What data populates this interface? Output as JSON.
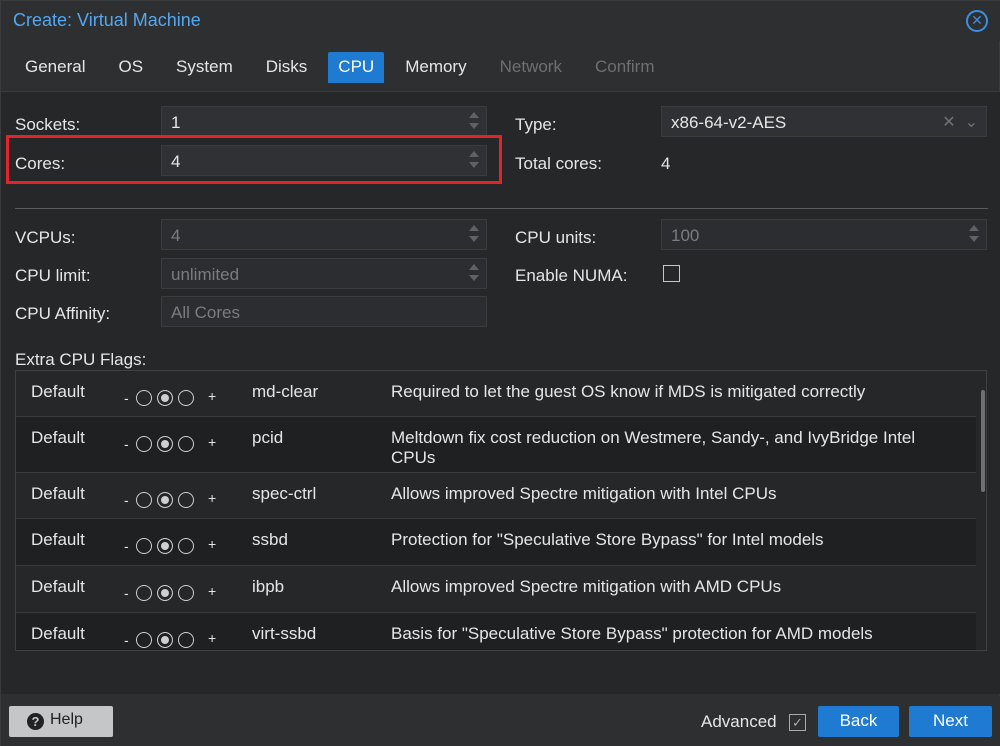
{
  "window": {
    "title": "Create: Virtual Machine"
  },
  "tabs": [
    {
      "label": "General",
      "state": "normal"
    },
    {
      "label": "OS",
      "state": "normal"
    },
    {
      "label": "System",
      "state": "normal"
    },
    {
      "label": "Disks",
      "state": "normal"
    },
    {
      "label": "CPU",
      "state": "active"
    },
    {
      "label": "Memory",
      "state": "normal"
    },
    {
      "label": "Network",
      "state": "disabled"
    },
    {
      "label": "Confirm",
      "state": "disabled"
    }
  ],
  "form": {
    "sockets": {
      "label": "Sockets:",
      "value": "1"
    },
    "cores": {
      "label": "Cores:",
      "value": "4"
    },
    "type": {
      "label": "Type:",
      "value": "x86-64-v2-AES"
    },
    "total_cores": {
      "label": "Total cores:",
      "value": "4"
    },
    "vcpus": {
      "label": "VCPUs:",
      "placeholder": "4"
    },
    "cpu_units": {
      "label": "CPU units:",
      "placeholder": "100"
    },
    "cpu_limit": {
      "label": "CPU limit:",
      "placeholder": "unlimited"
    },
    "enable_numa": {
      "label": "Enable NUMA:",
      "checked": false
    },
    "cpu_affinity": {
      "label": "CPU Affinity:",
      "placeholder": "All Cores"
    },
    "extra_flags_label": "Extra CPU Flags:"
  },
  "flags": [
    {
      "state": "Default",
      "minus": "-",
      "plus": "+",
      "name": "md-clear",
      "description": "Required to let the guest OS know if MDS is mitigated correctly"
    },
    {
      "state": "Default",
      "minus": "-",
      "plus": "+",
      "name": "pcid",
      "description": "Meltdown fix cost reduction on Westmere, Sandy-, and IvyBridge Intel CPUs"
    },
    {
      "state": "Default",
      "minus": "-",
      "plus": "+",
      "name": "spec-ctrl",
      "description": "Allows improved Spectre mitigation with Intel CPUs"
    },
    {
      "state": "Default",
      "minus": "-",
      "plus": "+",
      "name": "ssbd",
      "description": "Protection for \"Speculative Store Bypass\" for Intel models"
    },
    {
      "state": "Default",
      "minus": "-",
      "plus": "+",
      "name": "ibpb",
      "description": "Allows improved Spectre mitigation with AMD CPUs"
    },
    {
      "state": "Default",
      "minus": "-",
      "plus": "+",
      "name": "virt-ssbd",
      "description": "Basis for \"Speculative Store Bypass\" protection for AMD models"
    }
  ],
  "footer": {
    "help_label": "Help",
    "advanced_label": "Advanced",
    "advanced_checked": true,
    "back_label": "Back",
    "next_label": "Next"
  },
  "colors": {
    "accent": "#1f7bd1",
    "title": "#53a7f0",
    "highlight": "#e0242a"
  }
}
